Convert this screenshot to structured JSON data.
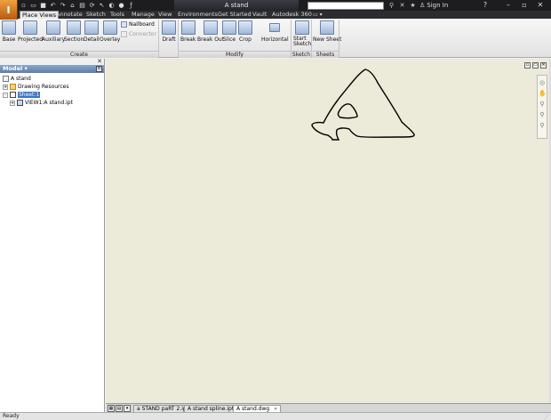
{
  "titlebar": {
    "document_title": "A stand",
    "search_placeholder": "",
    "sign_in": "Sign In",
    "help": "?"
  },
  "tabs": [
    {
      "label": "Place Views",
      "active": true
    },
    {
      "label": "Annotate"
    },
    {
      "label": "Sketch"
    },
    {
      "label": "Tools"
    },
    {
      "label": "Manage"
    },
    {
      "label": "View"
    },
    {
      "label": "Environments"
    },
    {
      "label": "Get Started"
    },
    {
      "label": "Vault"
    },
    {
      "label": "Autodesk 360"
    }
  ],
  "ribbon": {
    "create": {
      "label": "Create",
      "buttons": [
        "Base",
        "Projected",
        "Auxiliary",
        "Section",
        "Detail",
        "Overlay"
      ],
      "nailboard": "Nailboard",
      "connector": "Connector",
      "draft": "Draft"
    },
    "modify": {
      "label": "Modify",
      "buttons": [
        "Break",
        "Break Out",
        "Slice",
        "Crop"
      ],
      "horizontal": "Horizontal"
    },
    "sketch": {
      "label": "Sketch",
      "start": "Start",
      "sketch": "Sketch"
    },
    "sheets": {
      "label": "Sheets",
      "new_sheet": "New Sheet"
    }
  },
  "browser": {
    "header": "Model",
    "tree": [
      {
        "label": "A stand",
        "indent": 0,
        "icon": "doc-icon"
      },
      {
        "label": "Drawing Resources",
        "indent": 1,
        "icon": "folder-icon",
        "expander": "+"
      },
      {
        "label": "Sheet:1",
        "indent": 1,
        "icon": "sheet-icon",
        "expander": "-",
        "selected": true
      },
      {
        "label": "VIEW1:A stand.ipt",
        "indent": 2,
        "icon": "view-icon",
        "expander": "+"
      }
    ]
  },
  "doc_tabs": [
    {
      "label": "a STAND paRT 2.ipt"
    },
    {
      "label": "A stand spline.ipt"
    },
    {
      "label": "A stand.dwg",
      "active": true
    }
  ],
  "status": {
    "text": "Ready"
  },
  "colors": {
    "canvas": "#ecead8",
    "titlebar": "#1d1d1f",
    "selection": "#3b74c8"
  }
}
